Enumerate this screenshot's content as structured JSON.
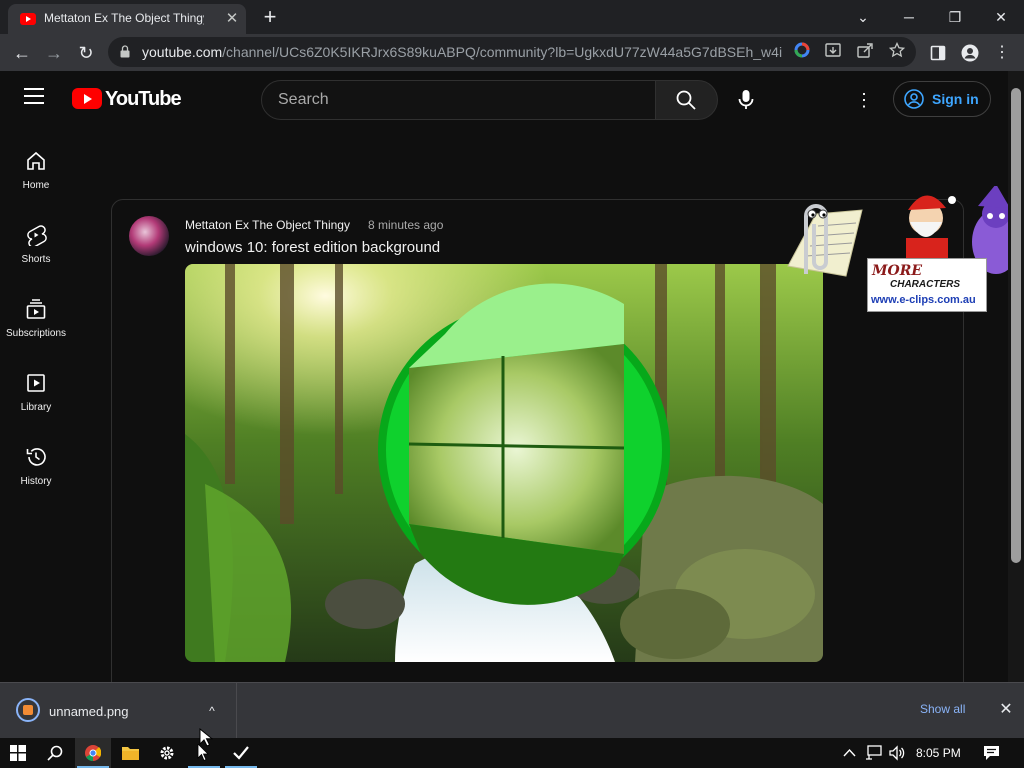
{
  "browser": {
    "tab_title": "Mettaton Ex The Object Thingy -",
    "tab_close": "✕",
    "new_tab": "+",
    "window_controls": {
      "tab_search": "⌄",
      "minimize": "─",
      "restore": "❐",
      "close": "✕"
    },
    "url_host": "youtube.com",
    "url_path": "/channel/UCs6Z0K5IKRJrx6S89kuABPQ/community?lb=UgkxdU77zW44a5G7dBSEh_w4iu...",
    "back": "←",
    "forward": "→",
    "reload": "↻"
  },
  "youtube": {
    "logo_text": "YouTube",
    "search_placeholder": "Search",
    "more": "⋮",
    "signin_label": "Sign in",
    "sidebar": [
      {
        "label": "Home",
        "icon": "home-icon"
      },
      {
        "label": "Shorts",
        "icon": "shorts-icon"
      },
      {
        "label": "Subscriptions",
        "icon": "subscriptions-icon"
      },
      {
        "label": "Library",
        "icon": "library-icon"
      },
      {
        "label": "History",
        "icon": "history-icon"
      }
    ],
    "post": {
      "author": "Mettaton Ex The Object Thingy",
      "time": "8 minutes ago",
      "text": "windows 10: forest edition background"
    }
  },
  "overlay_ad": {
    "line1": "MORE",
    "line2": "CHARACTERS",
    "url": "www.e-clips.com.au"
  },
  "downloads": {
    "filename": "unnamed.png",
    "chevron": "^",
    "show_all": "Show all",
    "close": "✕"
  },
  "taskbar": {
    "clock": "8:05 PM"
  },
  "colors": {
    "youtube_red": "#ff0000",
    "link_blue": "#3ea6ff",
    "windows_green": "#00cc00"
  }
}
